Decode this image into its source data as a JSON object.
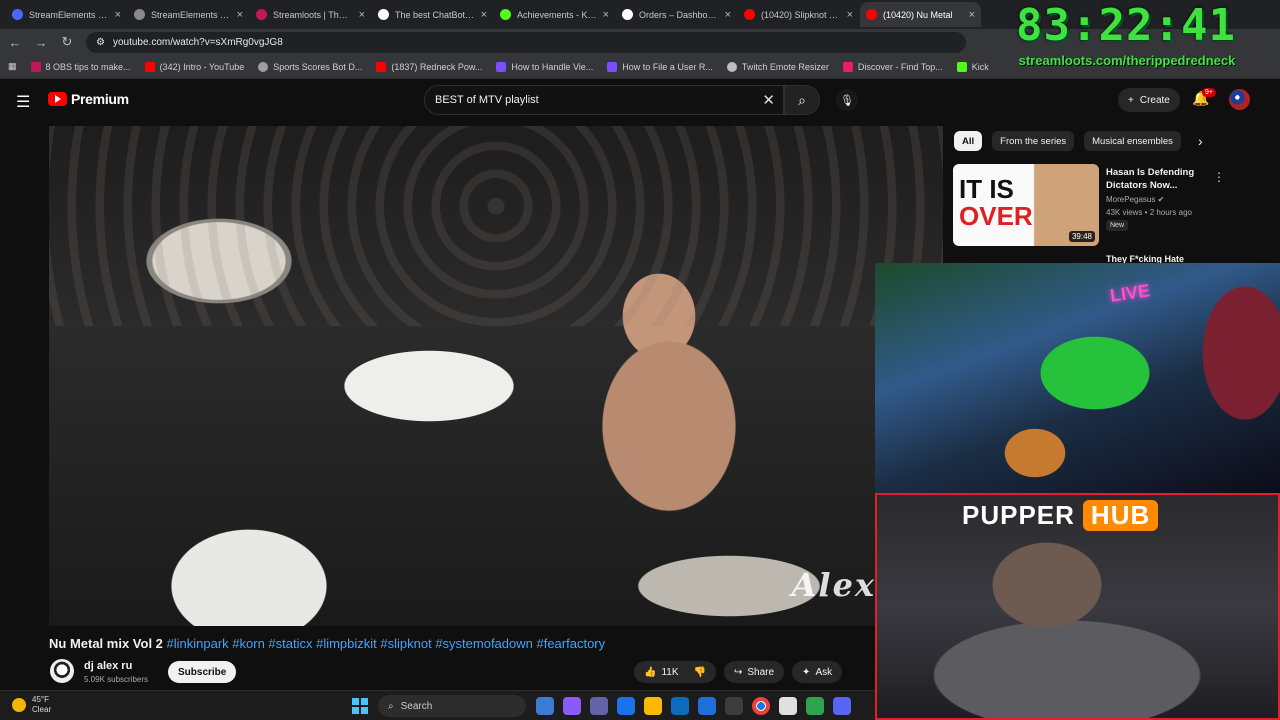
{
  "tabs": [
    {
      "title": "StreamElements - Ov",
      "color": "#4a68ff"
    },
    {
      "title": "StreamElements - rip",
      "color": "#8a8a8a"
    },
    {
      "title": "Streamloots | Therip",
      "color": "#c2185b"
    },
    {
      "title": "The best ChatBot and",
      "color": "#ffffff"
    },
    {
      "title": "Achievements - Kick",
      "color": "#53fc18"
    },
    {
      "title": "Orders – Dashboard",
      "color": "#ffffff"
    },
    {
      "title": "(10420) Slipknot - Du",
      "color": "#ff0000"
    },
    {
      "title": "(10420) Nu Metal",
      "color": "#ff0000",
      "active": true
    }
  ],
  "address": {
    "url": "youtube.com/watch?v=sXmRg0vgJG8"
  },
  "bookmarks": [
    {
      "label": "8 OBS tips to make...",
      "color": "#c2185b"
    },
    {
      "label": "(342) Intro - YouTube",
      "color": "#ff0000"
    },
    {
      "label": "Sports Scores Bot D...",
      "color": "#9e9e9e"
    },
    {
      "label": "(1837) Redneck Pow...",
      "color": "#ff0000"
    },
    {
      "label": "How to Handle Vie...",
      "color": "#7b4dff"
    },
    {
      "label": "How to File a User R...",
      "color": "#7b4dff"
    },
    {
      "label": "Twitch Emote Resizer",
      "color": "#bdbdbd"
    },
    {
      "label": "Discover - Find Top...",
      "color": "#e91e63"
    },
    {
      "label": "Kick",
      "color": "#53fc18"
    }
  ],
  "youtube": {
    "brand": "Premium",
    "search_value": "BEST of MTV playlist",
    "create_label": "Create",
    "notif_count": "9+"
  },
  "video": {
    "watermark": "Alex Ru",
    "title": "Nu Metal mix Vol 2",
    "hashtags": "#linkinpark #korn #staticx #limpbizkit #slipknot #systemofadown #fearfactory",
    "channel": "dj alex ru",
    "subscribers": "5.09K subscribers",
    "subscribe_label": "Subscribe",
    "likes": "11K",
    "share_label": "Share",
    "ask_label": "Ask"
  },
  "chips": [
    "All",
    "From the series",
    "Musical ensembles"
  ],
  "recommendation": {
    "thumb_line1": "IT IS",
    "thumb_line2": "OVER",
    "duration": "39:48",
    "title": "Hasan Is Defending Dictators Now...",
    "channel": "MorePegasus",
    "meta": "43K views • 2 hours ago",
    "badge": "New"
  },
  "recommendation2_title": "They F*cking Hate",
  "overlay": {
    "timer": "83:22:41",
    "url": "streamloots.com/therippedredneck",
    "cam_sign": "LIVE",
    "hub_word1": "PUPPER",
    "hub_word2": "HUB"
  },
  "taskbar": {
    "temp": "45°F",
    "condition": "Clear",
    "search_label": "Search",
    "icons": [
      "#3b7bd8",
      "#8a5cf6",
      "#1a73e8",
      "#ffb900",
      "#0f6cbd",
      "#1e6fd9",
      "#3c3c3c",
      "#e0e0e0",
      "#2ea44f",
      "#5865f2"
    ]
  }
}
